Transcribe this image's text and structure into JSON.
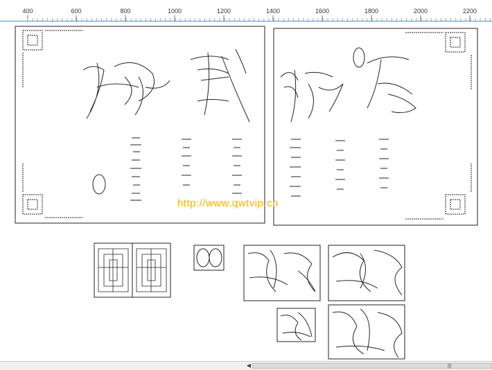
{
  "ruler": {
    "labels": [
      "400",
      "600",
      "800",
      "1000",
      "1200",
      "1400",
      "1600",
      "1800",
      "2000",
      "2200"
    ]
  },
  "watermark": {
    "text": "http://www.qwtvip.cn"
  },
  "scrollbar": {
    "left_arrow": "◀",
    "grip": "|||"
  },
  "colors": {
    "ruler_line": "#4a90c8",
    "watermark": "#f4b400",
    "stroke": "#222222"
  }
}
